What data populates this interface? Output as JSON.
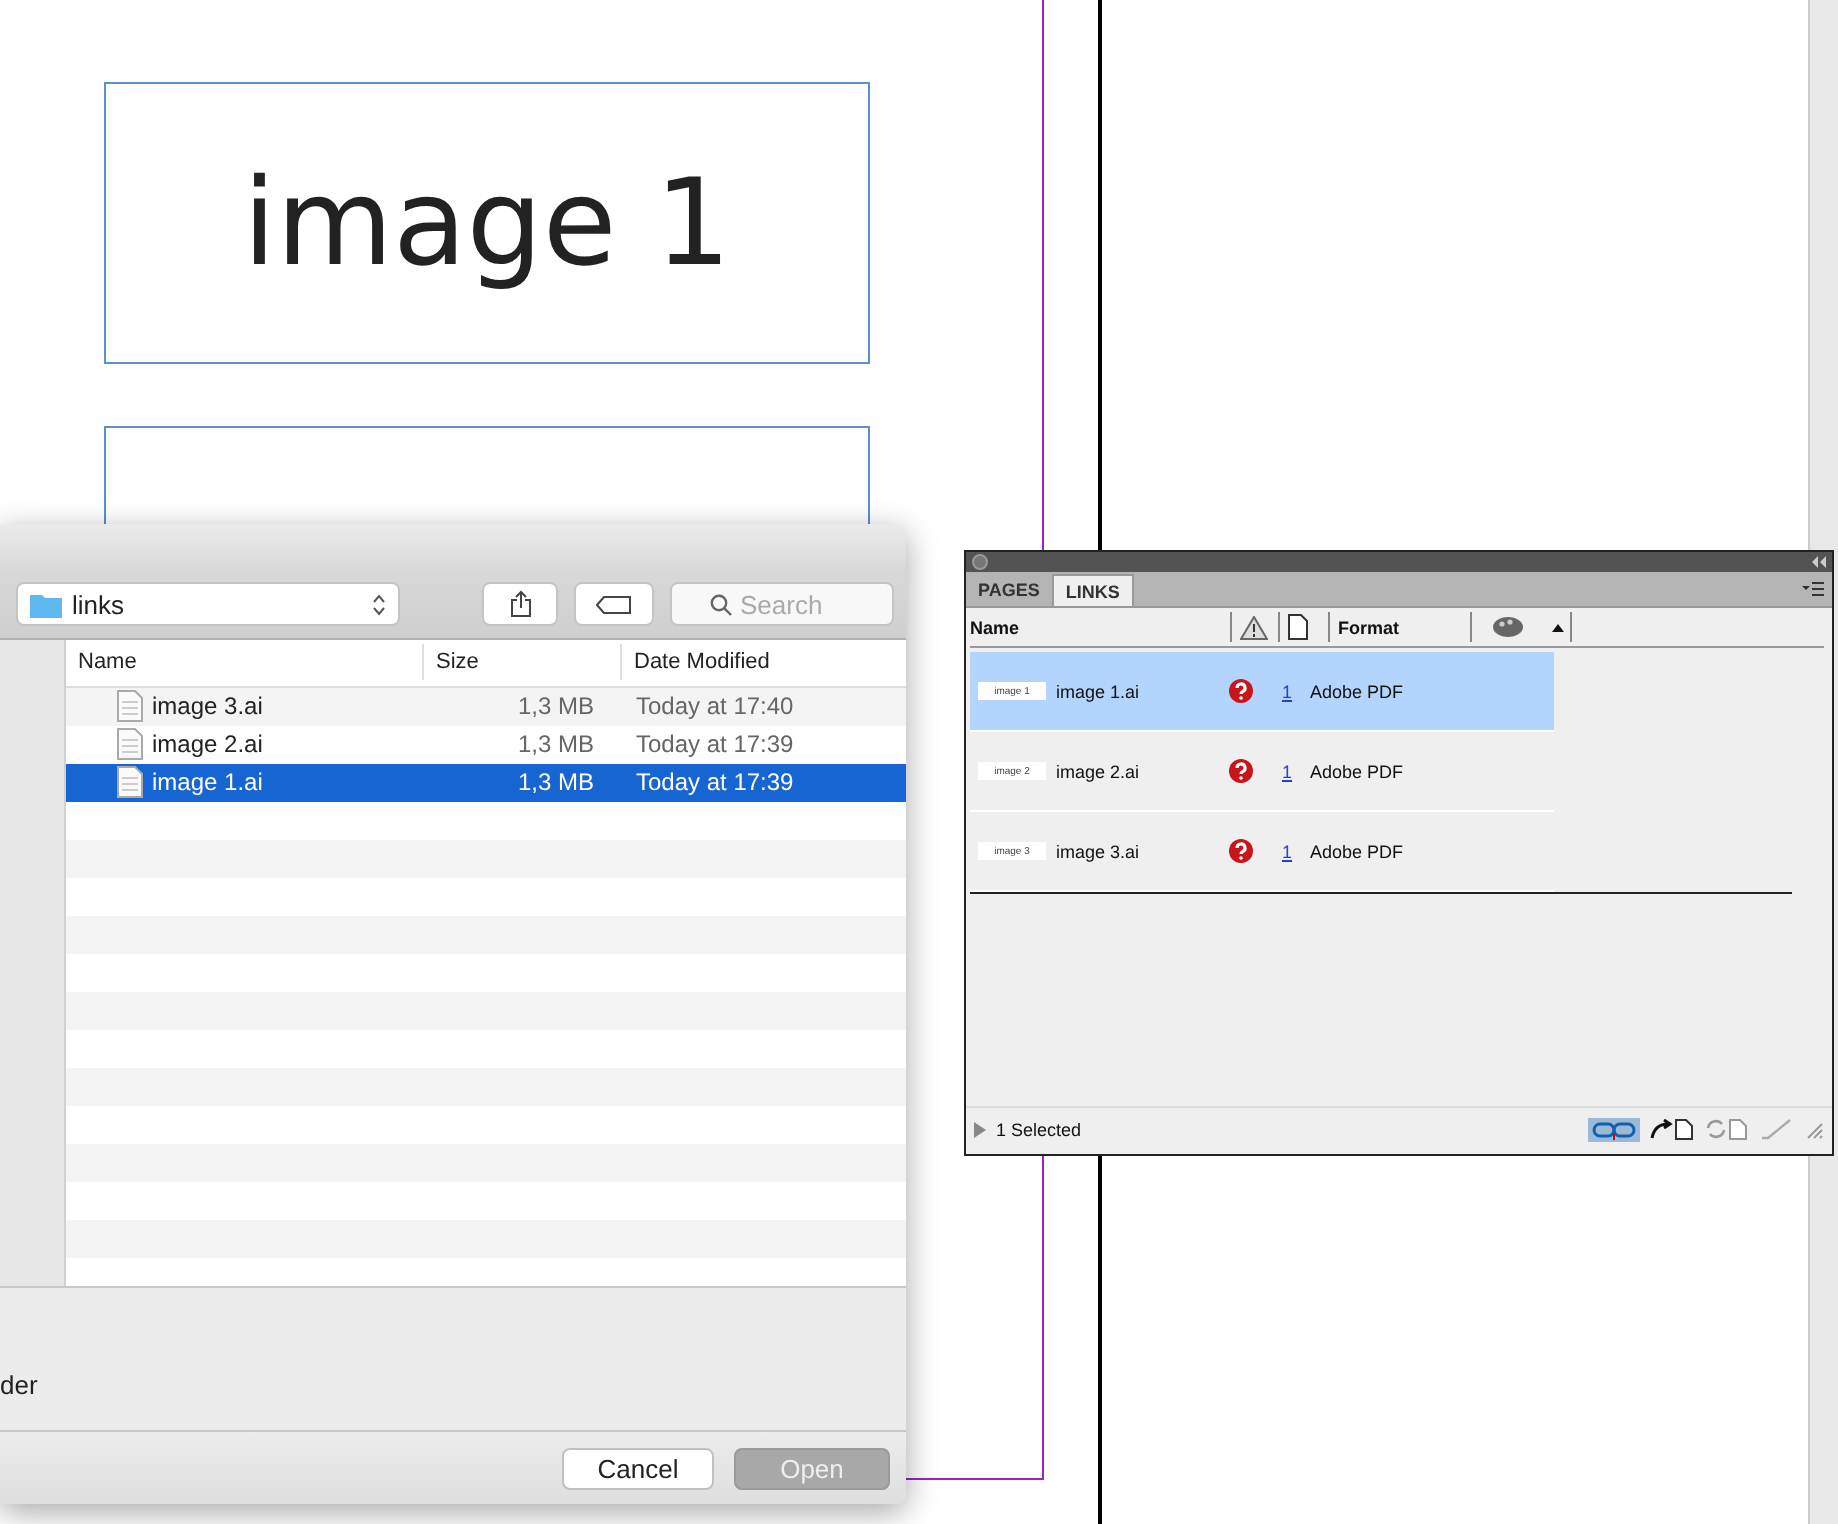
{
  "document": {
    "frames": [
      {
        "label": "image 1"
      }
    ]
  },
  "open_dialog": {
    "location": "links",
    "search": {
      "placeholder": "Search"
    },
    "columns": [
      "Name",
      "Size",
      "Date Modified"
    ],
    "files": [
      {
        "name": "image 3.ai",
        "size": "1,3 MB",
        "modified": "Today at 17:40",
        "selected": false
      },
      {
        "name": "image 2.ai",
        "size": "1,3 MB",
        "modified": "Today at 17:39",
        "selected": false
      },
      {
        "name": "image 1.ai",
        "size": "1,3 MB",
        "modified": "Today at 17:39",
        "selected": true
      }
    ],
    "option_label": "der",
    "buttons": [
      {
        "label": "Cancel",
        "disabled": false
      },
      {
        "label": "Open",
        "disabled": true
      }
    ]
  },
  "links_panel": {
    "tabs": [
      {
        "label": "PAGES",
        "selected": false
      },
      {
        "label": "LINKS",
        "selected": true
      }
    ],
    "columns": {
      "name": "Name",
      "format": "Format"
    },
    "links": [
      {
        "thumbnail": "image 1",
        "name": "image 1.ai",
        "missing": true,
        "page": "1",
        "format": "Adobe PDF",
        "selected": true
      },
      {
        "thumbnail": "image 2",
        "name": "image 2.ai",
        "missing": true,
        "page": "1",
        "format": "Adobe PDF",
        "selected": false
      },
      {
        "thumbnail": "image 3",
        "name": "image 3.ai",
        "missing": true,
        "page": "1",
        "format": "Adobe PDF",
        "selected": false
      }
    ],
    "status_text": "1 Selected"
  }
}
